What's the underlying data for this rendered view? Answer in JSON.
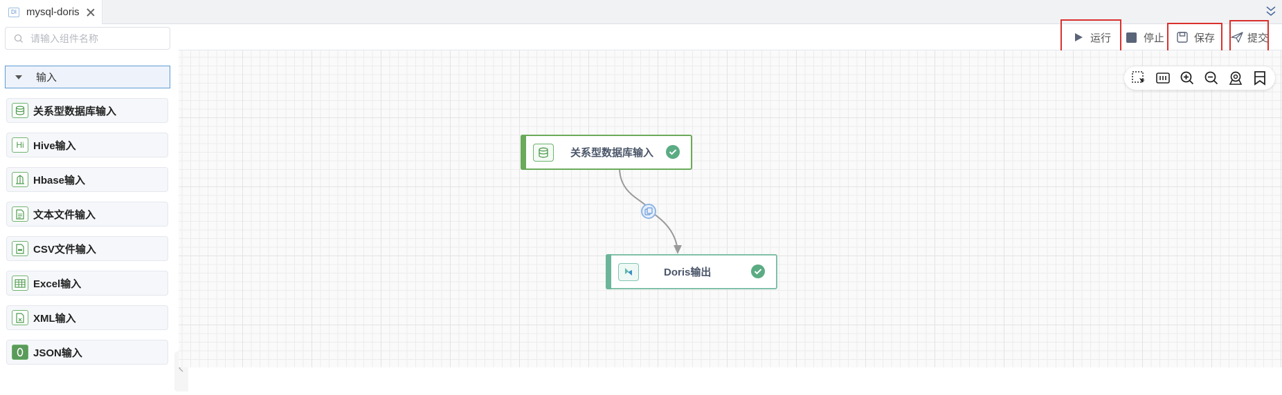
{
  "tab": {
    "icon_text": "DI",
    "label": "mysql-doris"
  },
  "sidebar": {
    "search_placeholder": "请输入组件名称",
    "group_label": "输入",
    "items": [
      {
        "label": "关系型数据库输入",
        "icon": "database-icon"
      },
      {
        "label": "Hive输入",
        "icon": "hive-icon",
        "icon_text": "Hi"
      },
      {
        "label": "Hbase输入",
        "icon": "hbase-icon"
      },
      {
        "label": "文本文件输入",
        "icon": "text-file-icon"
      },
      {
        "label": "CSV文件输入",
        "icon": "csv-file-icon"
      },
      {
        "label": "Excel输入",
        "icon": "excel-table-icon"
      },
      {
        "label": "XML输入",
        "icon": "xml-file-icon"
      },
      {
        "label": "JSON输入",
        "icon": "json-icon"
      }
    ]
  },
  "toolbar": {
    "run_label": "运行",
    "stop_label": "停止",
    "save_label": "保存",
    "submit_label": "提交"
  },
  "nodes": [
    {
      "label": "关系型数据库输入",
      "status": "success"
    },
    {
      "label": "Doris输出",
      "status": "success"
    }
  ],
  "colors": {
    "accent": "#5b9bd5",
    "node_green": "#6aaa5a",
    "check_green": "#5bab83",
    "highlight_red": "#d9302c"
  }
}
